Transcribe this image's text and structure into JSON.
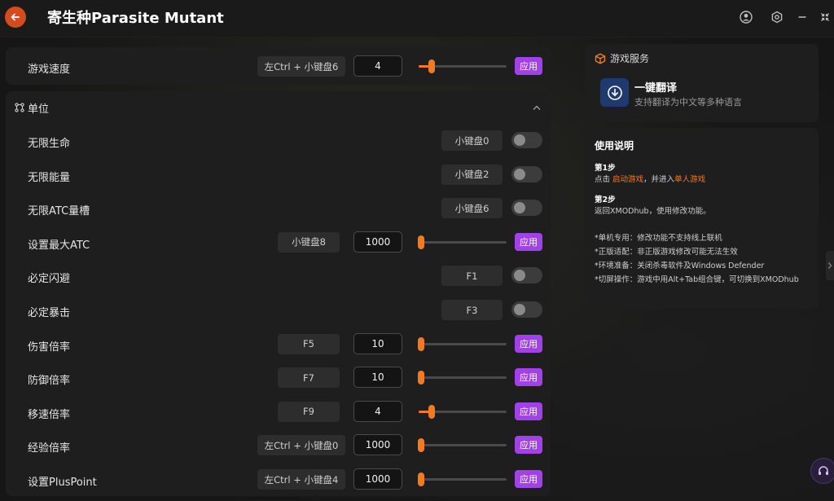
{
  "header": {
    "title": "寄生种Parasite Mutant"
  },
  "speed_row": {
    "label": "游戏速度",
    "hotkey": "左Ctrl + 小键盘6",
    "value": "4",
    "slider_fraction": 0.15,
    "apply_label": "应用"
  },
  "units": {
    "title": "单位",
    "rows": [
      {
        "label": "无限生命",
        "type": "toggle",
        "hotkey": "小键盘0"
      },
      {
        "label": "无限能量",
        "type": "toggle",
        "hotkey": "小键盘2"
      },
      {
        "label": "无限ATC量槽",
        "type": "toggle",
        "hotkey": "小键盘6"
      },
      {
        "label": "设置最大ATC",
        "type": "slider",
        "hotkey": "小键盘8",
        "value": "1000",
        "slider_fraction": 0.03,
        "apply_label": "应用"
      },
      {
        "label": "必定闪避",
        "type": "toggle",
        "hotkey": "F1"
      },
      {
        "label": "必定暴击",
        "type": "toggle",
        "hotkey": "F3"
      },
      {
        "label": "伤害倍率",
        "type": "slider",
        "hotkey": "F5",
        "value": "10",
        "slider_fraction": 0.03,
        "apply_label": "应用"
      },
      {
        "label": "防御倍率",
        "type": "slider",
        "hotkey": "F7",
        "value": "10",
        "slider_fraction": 0.03,
        "apply_label": "应用"
      },
      {
        "label": "移速倍率",
        "type": "slider",
        "hotkey": "F9",
        "value": "4",
        "slider_fraction": 0.15,
        "apply_label": "应用"
      },
      {
        "label": "经验倍率",
        "type": "slider",
        "hotkey": "左Ctrl + 小键盘0",
        "value": "1000",
        "slider_fraction": 0.03,
        "apply_label": "应用"
      },
      {
        "label": "设置PlusPoint",
        "type": "slider",
        "hotkey": "左Ctrl + 小键盘4",
        "value": "1000",
        "slider_fraction": 0.03,
        "apply_label": "应用"
      }
    ]
  },
  "service": {
    "title": "游戏服务",
    "item_title": "一键翻译",
    "item_desc": "支持翻译为中文等多种语言"
  },
  "guide": {
    "title": "使用说明",
    "step1_title": "第1步",
    "step1_pre": "点击 ",
    "step1_link1": "启动游戏",
    "step1_mid": "，并进入",
    "step1_link2": "单人游戏",
    "step2_title": "第2步",
    "step2_text": "返回XMODhub，使用修改功能。",
    "notes": [
      "*单机专用：修改功能不支持线上联机",
      "*正版适配：非正版游戏修改可能无法生效",
      "*环境准备：关闭杀毒软件及Windows Defender",
      "*切屏操作：游戏中用Alt+Tab组合键，可切换到XMODhub"
    ]
  },
  "colors": {
    "accent_orange": "#f07b23",
    "apply_purple": "#a142e8",
    "back_red": "#d44b1e"
  }
}
